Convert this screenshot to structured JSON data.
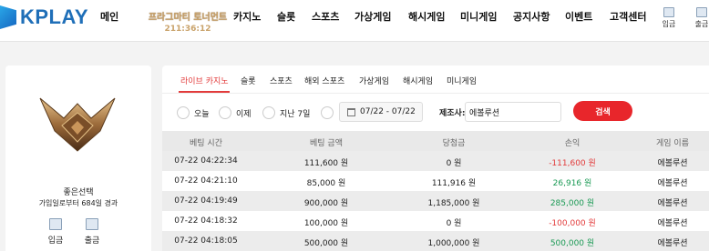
{
  "header": {
    "logo_text": "KPLAY",
    "nav": [
      "메인",
      "카지노",
      "슬롯",
      "스포츠",
      "가상게임",
      "해시게임",
      "미니게임",
      "공지사항",
      "이벤트",
      "고객센터"
    ],
    "promo_title": "프라그마티 토너먼트",
    "promo_timer": "211:36:12",
    "deposit_label": "입금",
    "withdraw_label": "출금"
  },
  "profile": {
    "rank_name": "좋은선택",
    "rank_info": "가입일로부터 684일 경과",
    "deposit_label": "입금",
    "withdraw_label": "출금"
  },
  "tabs": [
    "라이브 카지노",
    "슬롯",
    "스포츠",
    "해외 스포츠",
    "가상게임",
    "해시게임",
    "미니게임"
  ],
  "active_tab": "라이브 카지노",
  "filters": {
    "options": [
      "오늘",
      "이제",
      "지난 7일"
    ],
    "date_range": "07/22 - 07/22",
    "maker_label": "제조사:",
    "maker_value": "에볼루션",
    "search_label": "검색"
  },
  "table": {
    "columns": [
      "베팅 시간",
      "베팅 금액",
      "당첨금",
      "손익",
      "게임 이름"
    ],
    "rows": [
      {
        "time": "07-22 04:22:34",
        "bet": "111,600 원",
        "win": "0 원",
        "pl": "-111,600 원",
        "pl_sign": "neg",
        "game": "에볼루션"
      },
      {
        "time": "07-22 04:21:10",
        "bet": "85,000 원",
        "win": "111,916 원",
        "pl": "26,916 원",
        "pl_sign": "pos",
        "game": "에볼루션"
      },
      {
        "time": "07-22 04:19:49",
        "bet": "900,000 원",
        "win": "1,185,000 원",
        "pl": "285,000 원",
        "pl_sign": "pos",
        "game": "에볼루션"
      },
      {
        "time": "07-22 04:18:32",
        "bet": "100,000 원",
        "win": "0 원",
        "pl": "-100,000 원",
        "pl_sign": "neg",
        "game": "에볼루션"
      },
      {
        "time": "07-22 04:18:05",
        "bet": "500,000 원",
        "win": "1,000,000 원",
        "pl": "500,000 원",
        "pl_sign": "pos",
        "game": "에볼루션"
      }
    ]
  },
  "colors": {
    "accent": "#e8262b",
    "positive": "#1b9a55",
    "negative": "#e23b3b",
    "brand": "#1f6fb8"
  }
}
